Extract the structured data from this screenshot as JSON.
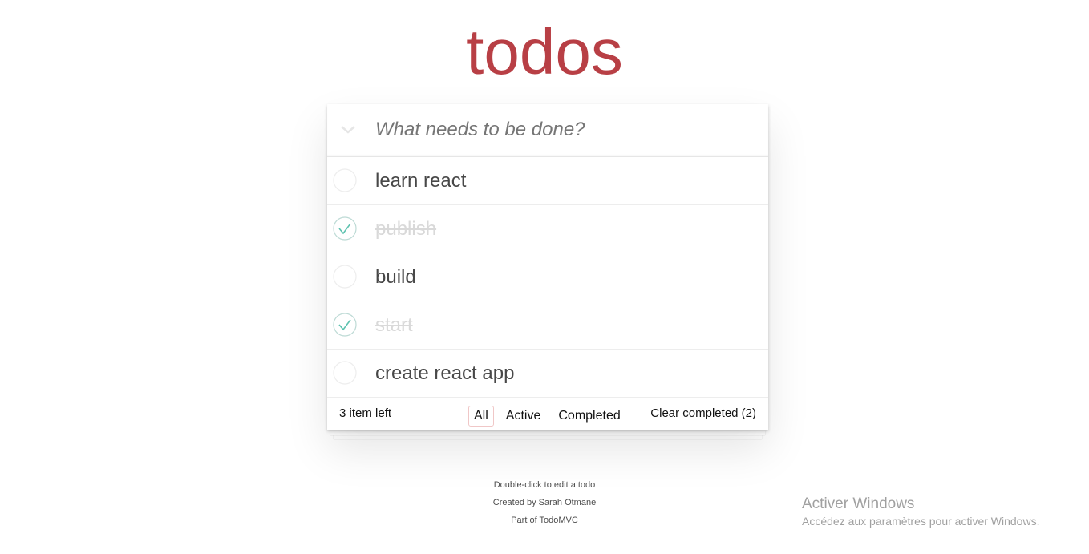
{
  "header": {
    "title": "todos",
    "input_placeholder": "What needs to be done?",
    "toggle_all_icon": "chevron-down-icon"
  },
  "todos": [
    {
      "label": "learn react",
      "completed": false
    },
    {
      "label": "publish",
      "completed": true
    },
    {
      "label": "build",
      "completed": false
    },
    {
      "label": "start",
      "completed": true
    },
    {
      "label": "create react app",
      "completed": false
    }
  ],
  "footer": {
    "count_text": "3 item left",
    "filters": [
      "All",
      "Active",
      "Completed"
    ],
    "selected_filter": "All",
    "clear_completed": "Clear completed (2)"
  },
  "info": {
    "line1": "Double-click to edit a todo",
    "line2": "Created by Sarah Otmane",
    "line3": "Part of TodoMVC"
  },
  "watermark": {
    "title": "Activer Windows",
    "subtitle": "Accédez aux paramètres pour activer Windows."
  },
  "colors": {
    "accent": "#b83f45",
    "check": "#5dc2af",
    "completed_text": "#d9d9d9"
  }
}
